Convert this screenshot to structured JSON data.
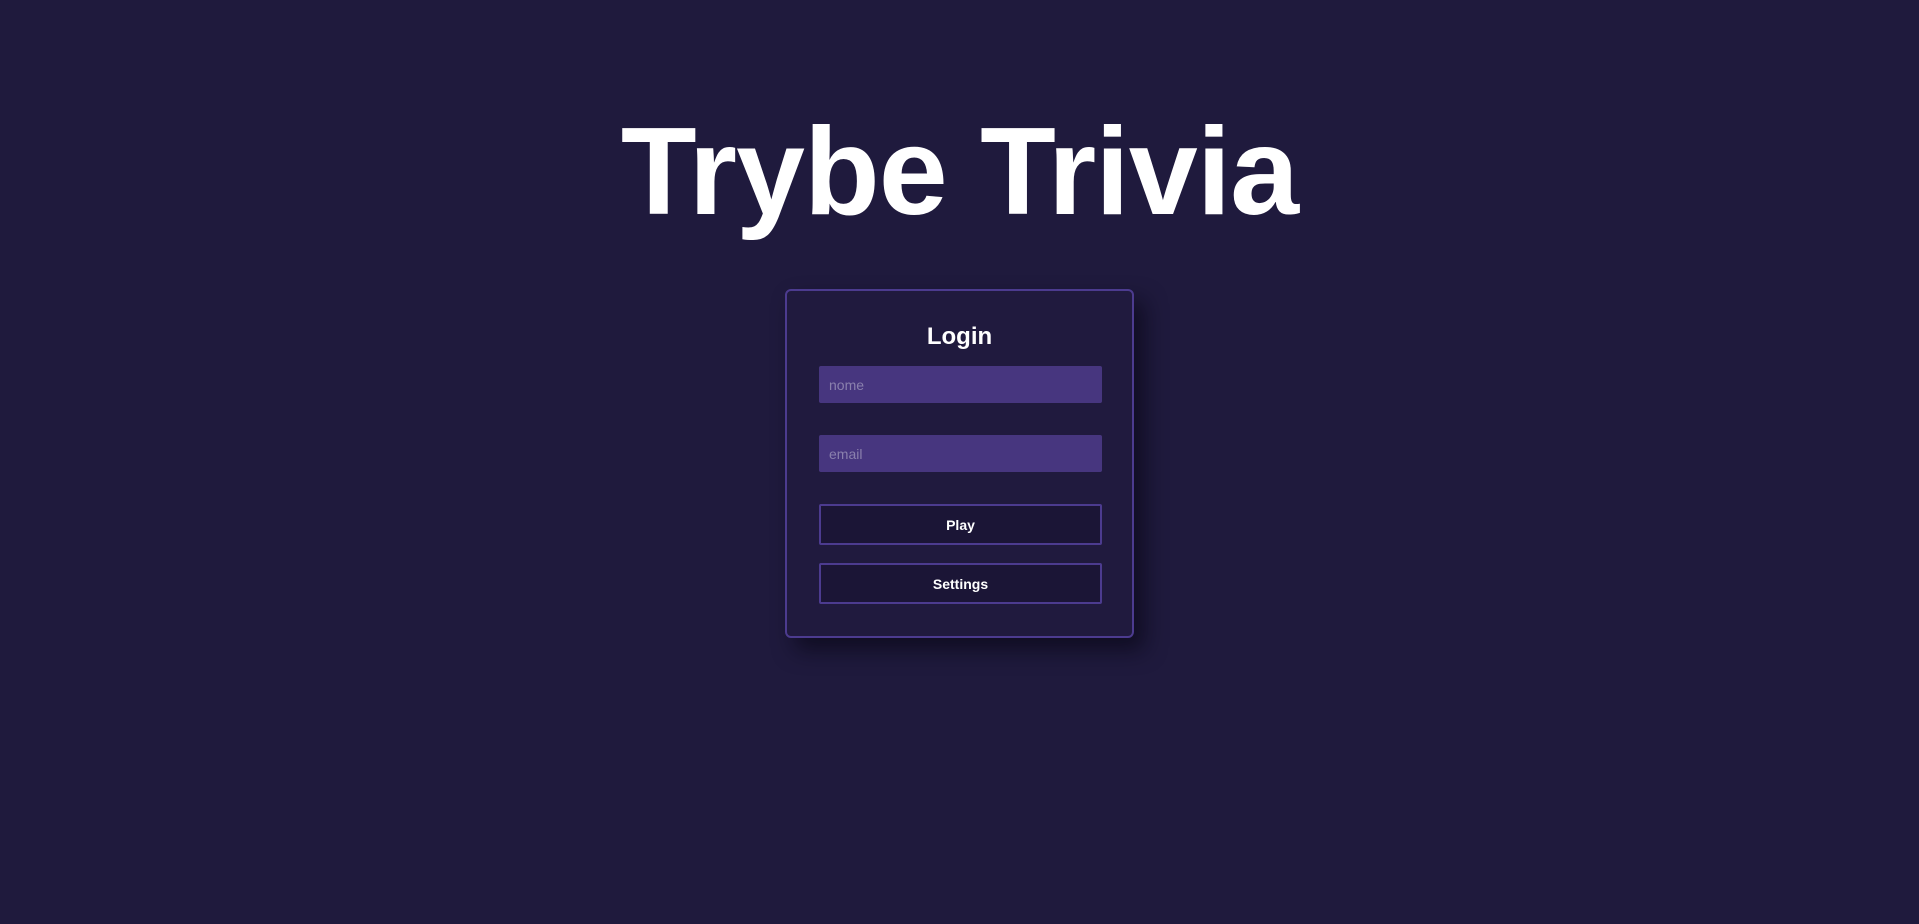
{
  "app": {
    "title": "Trybe Trivia"
  },
  "login": {
    "heading": "Login",
    "name_placeholder": "nome",
    "email_placeholder": "email",
    "play_label": "Play",
    "settings_label": "Settings"
  },
  "colors": {
    "background": "#1f1a3d",
    "card_border": "#4c3b8f",
    "input_fill": "#47367f",
    "text": "#ffffff"
  }
}
